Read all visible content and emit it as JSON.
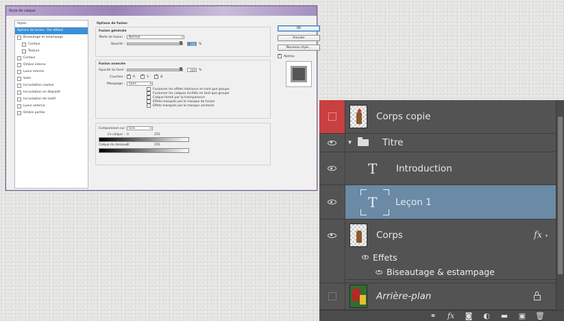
{
  "dialog": {
    "title": "Style de calque",
    "styles_header": "Styles",
    "styles": [
      {
        "label": "Options de fusion : Par défaut",
        "selected": true,
        "checkbox": false,
        "indent": false
      },
      {
        "label": "Biseautage et estampage",
        "selected": false,
        "checkbox": true,
        "indent": false
      },
      {
        "label": "Contour",
        "selected": false,
        "checkbox": true,
        "indent": true
      },
      {
        "label": "Texture",
        "selected": false,
        "checkbox": true,
        "indent": true
      },
      {
        "label": "Contour",
        "selected": false,
        "checkbox": true,
        "indent": false
      },
      {
        "label": "Ombre interne",
        "selected": false,
        "checkbox": true,
        "indent": false
      },
      {
        "label": "Lueur interne",
        "selected": false,
        "checkbox": true,
        "indent": false
      },
      {
        "label": "Satin",
        "selected": false,
        "checkbox": true,
        "indent": false
      },
      {
        "label": "Incrustation couleur",
        "selected": false,
        "checkbox": true,
        "indent": false
      },
      {
        "label": "Incrustation en dégradé",
        "selected": false,
        "checkbox": true,
        "indent": false
      },
      {
        "label": "Incrustation de motif",
        "selected": false,
        "checkbox": true,
        "indent": false
      },
      {
        "label": "Lueur externe",
        "selected": false,
        "checkbox": true,
        "indent": false
      },
      {
        "label": "Ombre portée",
        "selected": false,
        "checkbox": true,
        "indent": false
      }
    ],
    "section_title": "Options de fusion",
    "general": {
      "label": "Fusion générale",
      "mode_label": "Mode de fusion :",
      "mode_value": "Normal",
      "opacity_label": "Opacité :",
      "opacity_value": "100",
      "unit": "%"
    },
    "advanced": {
      "label": "Fusion avancée",
      "fill_label": "Opacité du fond :",
      "fill_value": "100",
      "unit": "%",
      "channels_label": "Couches :",
      "channels": [
        "R",
        "V",
        "B"
      ],
      "knockout_label": "Masquage :",
      "knockout_value": "Sans",
      "options": [
        {
          "label": "Fusionner les effets intérieurs en tant que groupe",
          "checked": false
        },
        {
          "label": "Fusionner les calques écrêtés en tant que groupe",
          "checked": true
        },
        {
          "label": "Calque formé par la transparence",
          "checked": true
        },
        {
          "label": "Effets masqués par le masque de fusion",
          "checked": false
        },
        {
          "label": "Effets masqués par le masque vectoriel",
          "checked": false
        }
      ]
    },
    "blendif": {
      "label": "Comparaison sur :",
      "value": "Gris",
      "this_layer_label": "Ce calque :",
      "this_layer_min": "0",
      "this_layer_max": "255",
      "underlying_label": "Calque du dessous :",
      "underlying_min": "0",
      "underlying_max": "255"
    },
    "buttons": {
      "ok": "OK",
      "cancel": "Annuler",
      "new_style": "Nouveau style..."
    },
    "preview_label": "Aperçu"
  },
  "layers": [
    {
      "name": "Corps copie",
      "kind": "image",
      "visible": false,
      "highlight": "red"
    },
    {
      "name": "Titre",
      "kind": "group",
      "visible": true
    },
    {
      "name": "Introduction",
      "kind": "text",
      "visible": true
    },
    {
      "name": "Leçon 1",
      "kind": "text",
      "visible": true,
      "selected": true
    },
    {
      "name": "Corps",
      "kind": "image",
      "visible": true,
      "has_fx": true
    },
    {
      "name": "Arrière-plan",
      "kind": "image",
      "visible": false,
      "locked": true
    }
  ],
  "effects": {
    "label": "Effets",
    "items": [
      "Biseautage & estampage"
    ]
  },
  "colors": {
    "panel": "#535353",
    "selected_row": "#6a8aa6",
    "red_highlight": "#c94040",
    "dialog_select": "#3d8fd8"
  }
}
